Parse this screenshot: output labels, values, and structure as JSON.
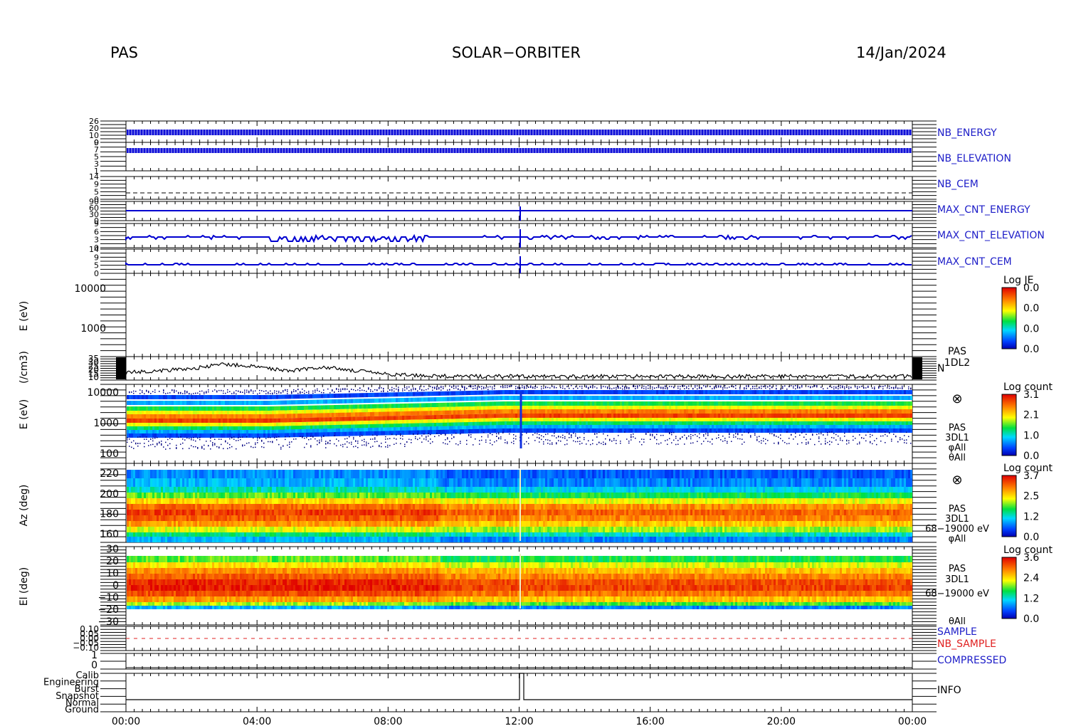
{
  "header": {
    "left": "PAS",
    "center": "SOLAR−ORBITER",
    "right": "14/Jan/2024"
  },
  "colors": {
    "panel_label_blue": "#1d1dc8",
    "nb_sample_red": "#e02020",
    "trace_blue": "#0000d0",
    "trace_black": "#000000"
  },
  "chart_data": [
    {
      "type": "line",
      "panel": "status-flags",
      "series": [
        {
          "name": "NB_ENERGY"
        },
        {
          "name": "NB_ELEVATION"
        },
        {
          "name": "NB_CEM"
        },
        {
          "name": "MAX_CNT_ENERGY"
        },
        {
          "name": "MAX_CNT_ELEVATION"
        },
        {
          "name": "MAX_CNT_CEM"
        }
      ]
    },
    {
      "type": "heatmap",
      "panel": "log-je",
      "ylabel": "E (eV)",
      "yscale": "log",
      "yticks": [
        "10000",
        "1000"
      ],
      "colorbar": {
        "title": "Log JE",
        "ticks": [
          "0.0",
          "0.0",
          "0.0",
          "0.0"
        ]
      }
    },
    {
      "type": "line",
      "panel": "density",
      "ylabel": "(/cm3)",
      "series_label": "N",
      "instrument": [
        "PAS",
        "1DL2"
      ],
      "ylim": [
        10,
        35
      ],
      "yticks": [
        "10",
        "15",
        "20",
        "25",
        "30",
        "35"
      ],
      "x": [
        "00:00",
        "02:00",
        "03:00",
        "04:00",
        "05:00",
        "06:00",
        "07:00",
        "08:00",
        "10:00",
        "12:00",
        "16:00",
        "20:00",
        "24:00"
      ],
      "values": [
        18,
        22,
        27,
        24,
        20,
        24,
        20,
        16,
        14,
        14,
        14,
        14,
        14
      ]
    },
    {
      "type": "heatmap",
      "panel": "energy-spectrogram",
      "ylabel": "E (eV)",
      "yscale": "log",
      "yticks": [
        "10000",
        "1000",
        "100"
      ],
      "instrument": [
        "PAS",
        "3DL1",
        "φAll",
        "θAll"
      ],
      "colorbar": {
        "title": "Log count",
        "ticks": [
          "3.1",
          "2.1",
          "1.0",
          "0.0"
        ]
      }
    },
    {
      "type": "heatmap",
      "panel": "azimuth-spectrogram",
      "ylabel": "Az (deg)",
      "yticks": [
        "220",
        "200",
        "180",
        "160"
      ],
      "instrument": [
        "PAS",
        "3DL1",
        "68−19000 eV",
        "φAll"
      ],
      "colorbar": {
        "title": "Log count",
        "ticks": [
          "3.7",
          "2.5",
          "1.2",
          "0.0"
        ]
      }
    },
    {
      "type": "heatmap",
      "panel": "elevation-spectrogram",
      "ylabel": "El (deg)",
      "yticks": [
        "30",
        "20",
        "10",
        "0",
        "−10",
        "−20",
        "−30"
      ],
      "instrument": [
        "PAS",
        "3DL1",
        "68−19000 eV",
        "θAll"
      ],
      "colorbar": {
        "title": "Log count",
        "ticks": [
          "3.6",
          "2.4",
          "1.2",
          "0.0"
        ]
      }
    },
    {
      "type": "line",
      "panel": "sample",
      "yticks": [
        "0.10",
        "0.05",
        "0.00",
        "−0.05",
        "−0.10"
      ],
      "series": [
        {
          "name": "SAMPLE"
        },
        {
          "name": "NB_SAMPLE"
        }
      ]
    },
    {
      "type": "line",
      "panel": "compressed",
      "yticks": [
        "1",
        "0"
      ],
      "series": [
        {
          "name": "COMPRESSED"
        }
      ]
    },
    {
      "type": "line",
      "panel": "info",
      "yticks": [
        "Calib",
        "Engineering",
        "Burst",
        "Snapshot",
        "Normal",
        "Ground"
      ],
      "series": [
        {
          "name": "INFO"
        }
      ]
    }
  ],
  "x_axis": {
    "ticks": [
      "00:00",
      "04:00",
      "08:00",
      "12:00",
      "16:00",
      "20:00",
      "00:00"
    ]
  }
}
